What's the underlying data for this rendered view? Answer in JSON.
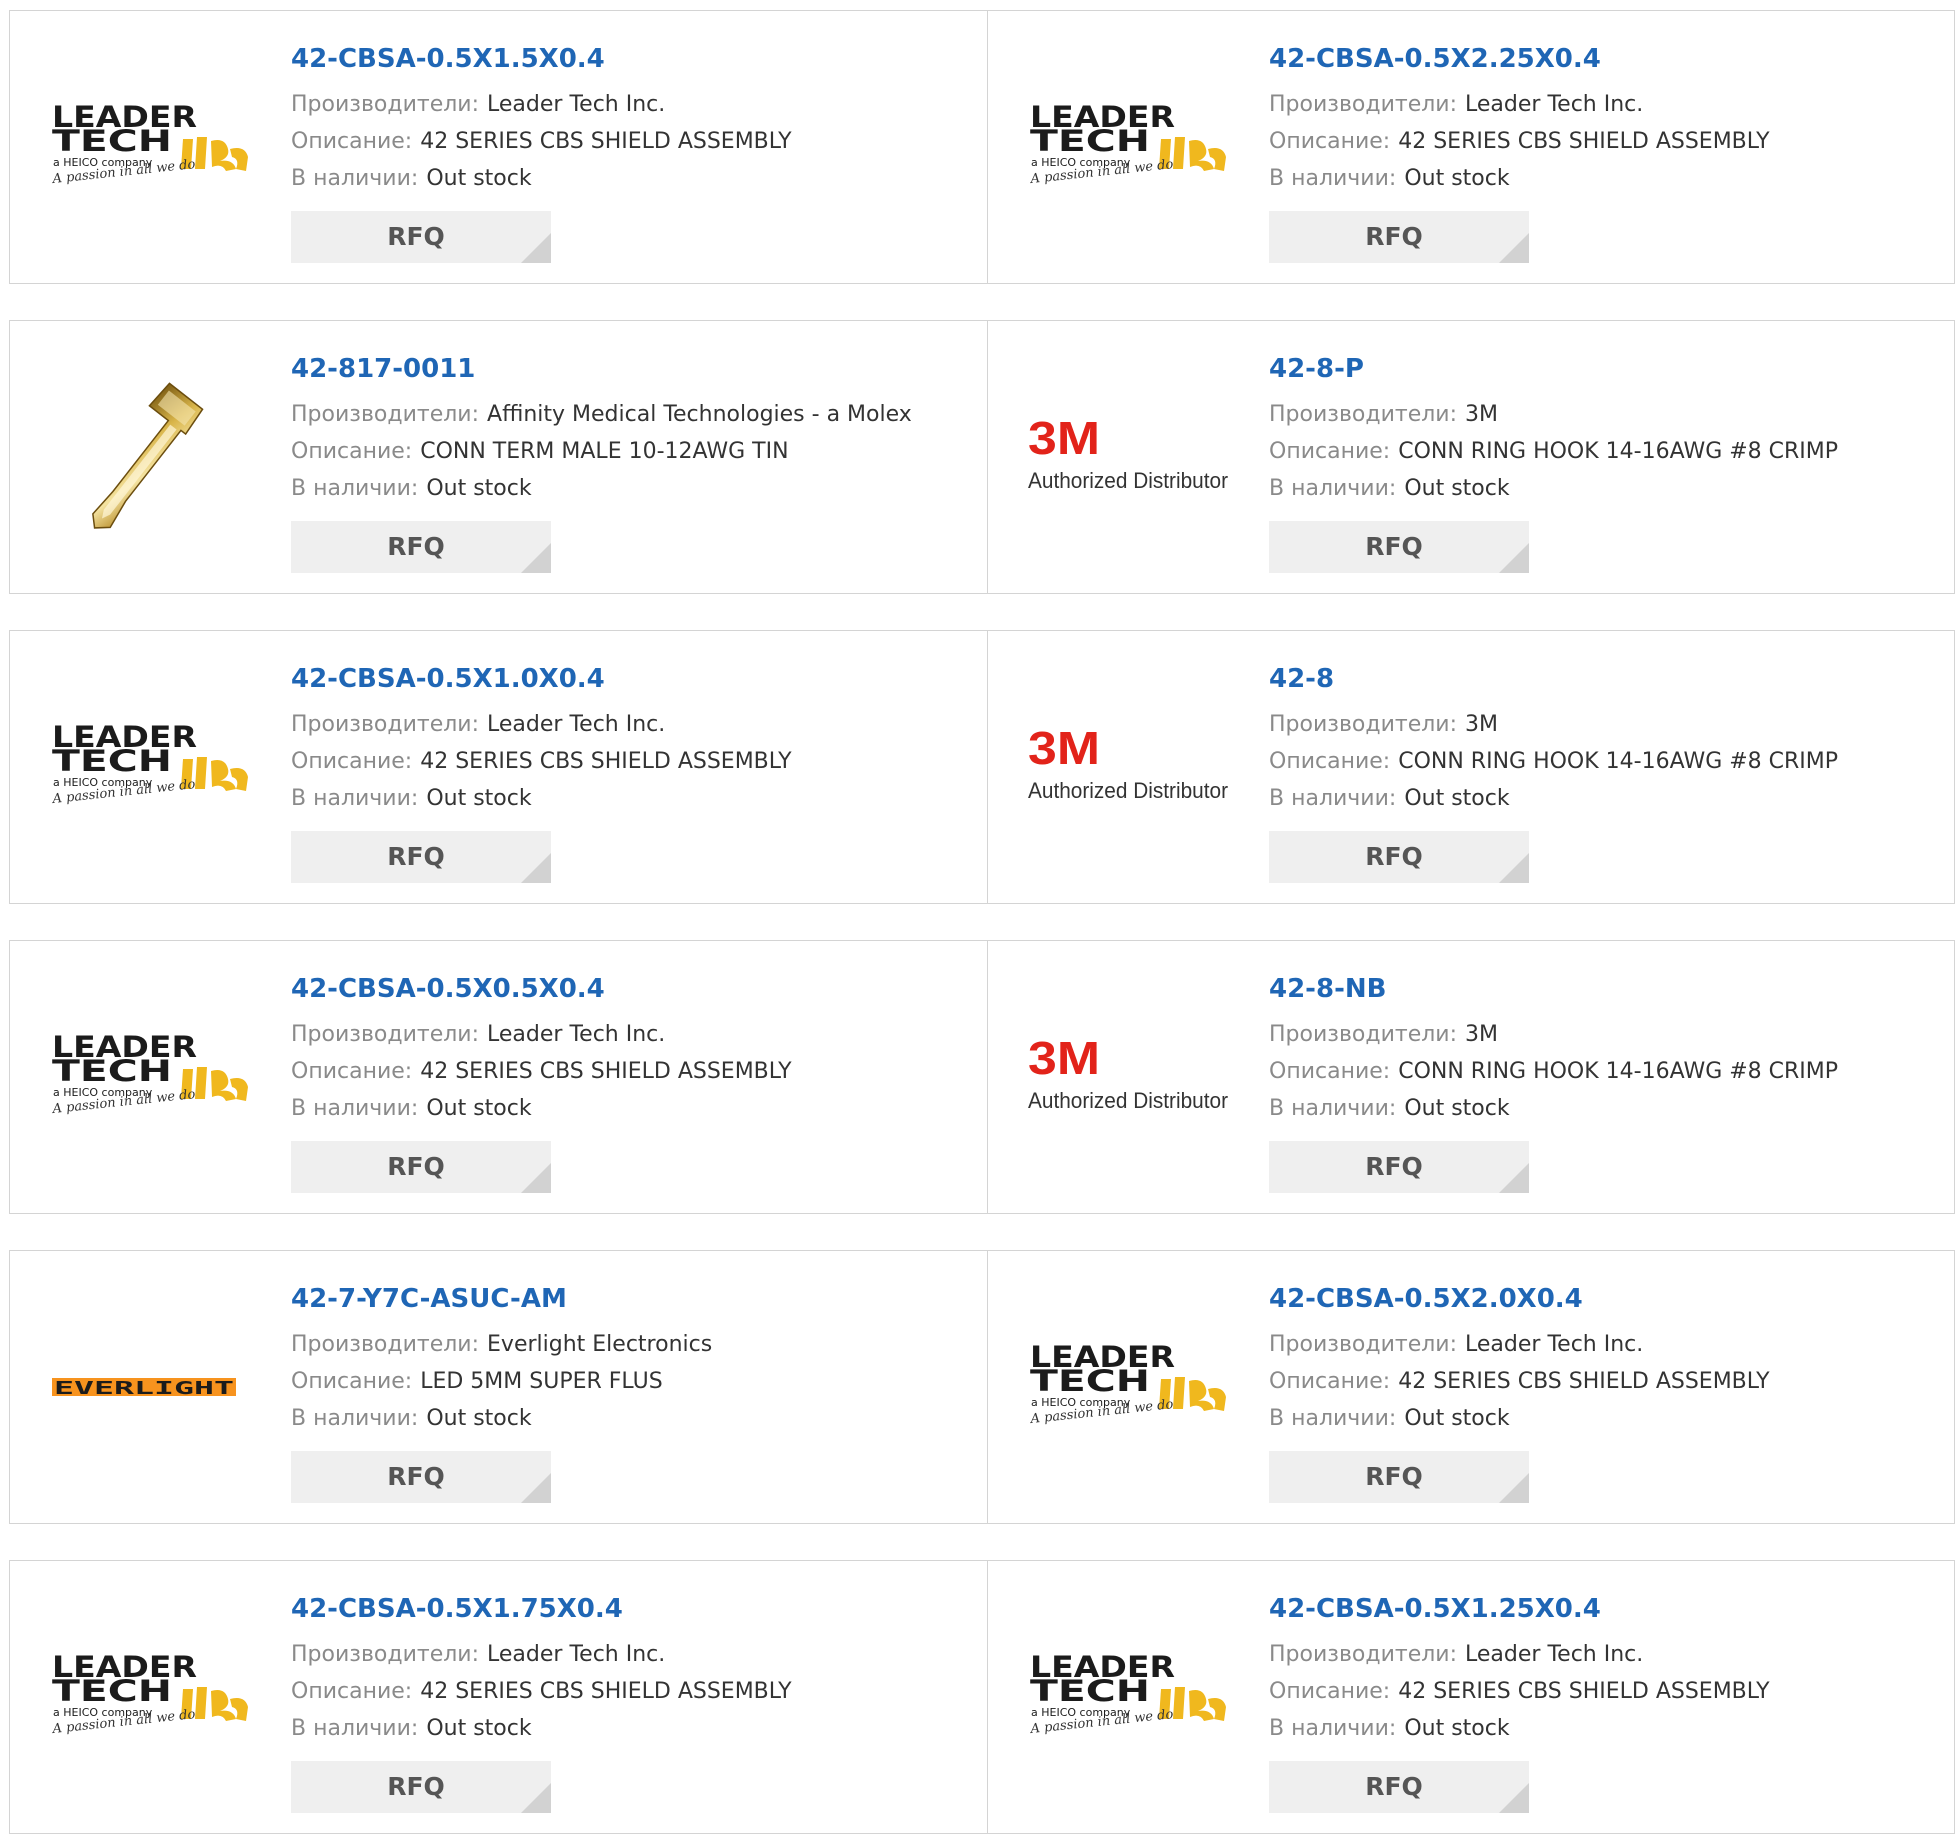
{
  "labels": {
    "manufacturer": "Производители:",
    "description": "Описание:",
    "stock": "В наличии:"
  },
  "rfq_label": "RFQ",
  "brand_colors": {
    "link": "#1f66b5",
    "threeM_red": "#e2231a",
    "leader_yellow": "#f0b81e",
    "everlight_orange": "#f7931e"
  },
  "logo_text": {
    "leader_line1": "LEADER",
    "leader_line2": "TECH",
    "leader_sub": "a HEICO company",
    "leader_script": "A passion in all we do",
    "threeM_mark": "3M",
    "threeM_sub": "Authorized Distributor",
    "everlight": "EVERLIGHT"
  },
  "rows": [
    [
      {
        "part": "42-CBSA-0.5X1.5X0.4",
        "manufacturer": "Leader Tech Inc.",
        "description": "42 SERIES CBS SHIELD ASSEMBLY",
        "stock": "Out stock",
        "logo": "leader-tech-logo"
      },
      {
        "part": "42-CBSA-0.5X2.25X0.4",
        "manufacturer": "Leader Tech Inc.",
        "description": "42 SERIES CBS SHIELD ASSEMBLY",
        "stock": "Out stock",
        "logo": "leader-tech-logo"
      }
    ],
    [
      {
        "part": "42-817-0011",
        "manufacturer": "Affinity Medical Technologies - a Molex",
        "description": "CONN TERM MALE 10-12AWG TIN",
        "stock": "Out stock",
        "logo": "terminal-photo"
      },
      {
        "part": "42-8-P",
        "manufacturer": "3M",
        "description": "CONN RING HOOK 14-16AWG #8 CRIMP",
        "stock": "Out stock",
        "logo": "3m-logo"
      }
    ],
    [
      {
        "part": "42-CBSA-0.5X1.0X0.4",
        "manufacturer": "Leader Tech Inc.",
        "description": "42 SERIES CBS SHIELD ASSEMBLY",
        "stock": "Out stock",
        "logo": "leader-tech-logo"
      },
      {
        "part": "42-8",
        "manufacturer": "3M",
        "description": "CONN RING HOOK 14-16AWG #8 CRIMP",
        "stock": "Out stock",
        "logo": "3m-logo"
      }
    ],
    [
      {
        "part": "42-CBSA-0.5X0.5X0.4",
        "manufacturer": "Leader Tech Inc.",
        "description": "42 SERIES CBS SHIELD ASSEMBLY",
        "stock": "Out stock",
        "logo": "leader-tech-logo"
      },
      {
        "part": "42-8-NB",
        "manufacturer": "3M",
        "description": "CONN RING HOOK 14-16AWG #8 CRIMP",
        "stock": "Out stock",
        "logo": "3m-logo"
      }
    ],
    [
      {
        "part": "42-7-Y7C-ASUC-AM",
        "manufacturer": "Everlight Electronics",
        "description": "LED 5MM SUPER FLUS",
        "stock": "Out stock",
        "logo": "everlight-logo"
      },
      {
        "part": "42-CBSA-0.5X2.0X0.4",
        "manufacturer": "Leader Tech Inc.",
        "description": "42 SERIES CBS SHIELD ASSEMBLY",
        "stock": "Out stock",
        "logo": "leader-tech-logo"
      }
    ],
    [
      {
        "part": "42-CBSA-0.5X1.75X0.4",
        "manufacturer": "Leader Tech Inc.",
        "description": "42 SERIES CBS SHIELD ASSEMBLY",
        "stock": "Out stock",
        "logo": "leader-tech-logo"
      },
      {
        "part": "42-CBSA-0.5X1.25X0.4",
        "manufacturer": "Leader Tech Inc.",
        "description": "42 SERIES CBS SHIELD ASSEMBLY",
        "stock": "Out stock",
        "logo": "leader-tech-logo"
      }
    ]
  ]
}
